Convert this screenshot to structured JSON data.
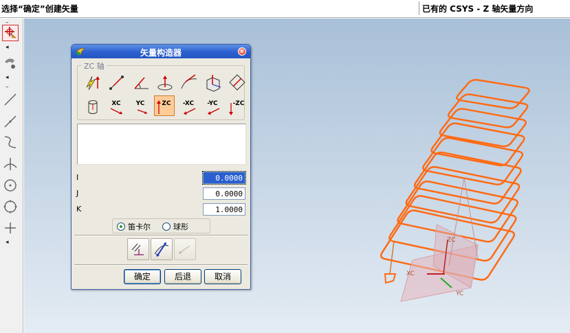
{
  "status": {
    "prompt": "选择“确定”创建矢量",
    "hint": "已有的 CSYS - Z 轴矢量方向"
  },
  "toolbar": {
    "items": [
      "point-icon",
      "selection-icon",
      "line-icon",
      "line-icon",
      "arc-icon",
      "perpendicular-icon",
      "circle-icon",
      "circle-icon",
      "plus-icon"
    ]
  },
  "dialog": {
    "title": "矢量构造器",
    "group_label": "ZC 轴",
    "vector_buttons_row2": [
      "",
      "XC",
      "YC",
      "ZC",
      "-XC",
      "-YC",
      "-ZC"
    ],
    "fields": [
      {
        "label": "I",
        "value": "0.0000"
      },
      {
        "label": "J",
        "value": "0.0000"
      },
      {
        "label": "K",
        "value": "1.0000"
      }
    ],
    "radio": {
      "options": [
        "笛卡尔",
        "球形"
      ],
      "selected": "笛卡尔"
    },
    "buttons": {
      "ok": "确定",
      "back": "后退",
      "cancel": "取消"
    }
  },
  "scene": {
    "axis_labels": {
      "z": "ZC",
      "y": "YC",
      "x": "XC"
    },
    "wire_color": "#ff6a14"
  }
}
